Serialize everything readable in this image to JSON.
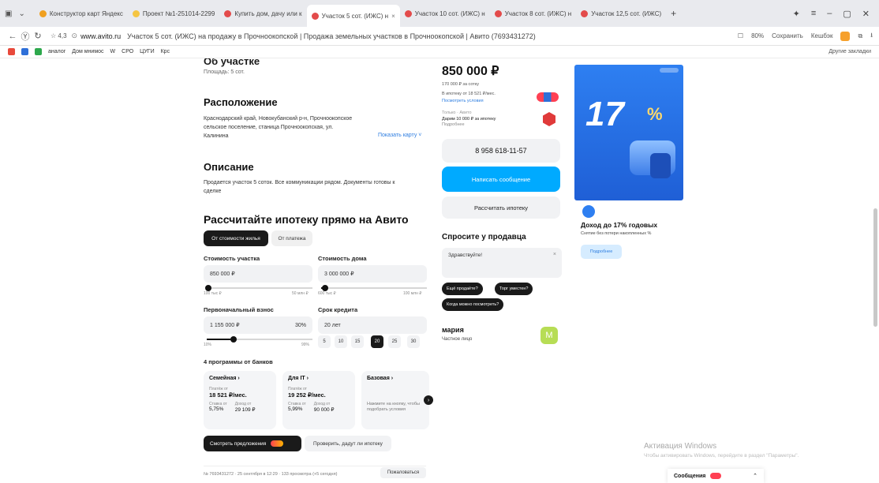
{
  "browser": {
    "tabs": [
      {
        "label": "Конструктор карт Яндекс",
        "color": "#f0a020"
      },
      {
        "label": "Проект №1-251014-2299",
        "color": "#f5c542"
      },
      {
        "label": "Купить дом, дачу или к",
        "color": "#e34b4b"
      },
      {
        "label": "Участок 5 сот. (ИЖС) н",
        "color": "#e34b4b"
      },
      {
        "label": "Участок 10 сот. (ИЖС) н",
        "color": "#e34b4b"
      },
      {
        "label": "Участок 8 сот. (ИЖС) н",
        "color": "#e34b4b"
      },
      {
        "label": "Участок 12,5 сот. (ИЖС)",
        "color": "#e34b4b"
      }
    ],
    "rating": "☆ 4,3",
    "url": "www.avito.ru",
    "page_title": "Участок 5 сот. (ИЖС) на продажу в Прочноокопской | Продажа земельных участков в Прочноокопской | Авито (7693431272)",
    "zoom": "80%",
    "save_label": "Сохранить",
    "cashback_label": "Кешбэк",
    "bookmarks": [
      "аналог",
      "Дом мнимос",
      "W",
      "СРО",
      "ЦУГИ",
      "Крс"
    ],
    "other_bookmarks": "Другие закладки"
  },
  "listing": {
    "about_title": "Об участке",
    "area": "Площадь: 5 сот.",
    "location_title": "Расположение",
    "address_line1": "Краснодарский край, Новокубанский р-н, Прочноокопское",
    "address_line2": "сельское поселение, станица Прочноокопская, ул.",
    "address_line3": "Калинина",
    "show_map": "Показать карту ˅",
    "description_title": "Описание",
    "description_line1": "Продается участок 5 соток. Все коммуникации рядом. Документы готовы к",
    "description_line2": "сделке"
  },
  "mortgage": {
    "title": "Рассчитайте ипотеку прямо на Авито",
    "toggle_by_price": "От стоимости жилья",
    "toggle_by_payment": "От платежа",
    "land_label": "Стоимость участка",
    "land_value": "850 000 ₽",
    "land_min": "100 тыс ₽",
    "land_max": "50 млн ₽",
    "house_label": "Стоимость дома",
    "house_value": "3 000 000 ₽",
    "house_min": "600 тыс ₽",
    "house_max": "100 млн ₽",
    "down_label": "Первоначальный взнос",
    "down_value": "1 155 000 ₽",
    "down_percent": "30%",
    "down_min": "10%",
    "down_max": "99%",
    "term_label": "Срок кредита",
    "term_value": "20 лет",
    "terms": [
      "5",
      "10",
      "15",
      "20",
      "25",
      "30"
    ],
    "programs_title": "4 программы от банков",
    "banks": [
      {
        "name": "Семейная ›",
        "cap": "Платёж от",
        "payment": "18 521 ₽/мес.",
        "rate_cap": "Ставка от",
        "rate": "5,75%",
        "down_cap": "Доход от",
        "down": "29 109 ₽"
      },
      {
        "name": "Для IT ›",
        "cap": "Платёж от",
        "payment": "19 252 ₽/мес.",
        "rate_cap": "Ставка от",
        "rate": "5,99%",
        "down_cap": "Доход от",
        "down": "90 000 ₽"
      },
      {
        "name": "Базовая ›",
        "note": "Нажмите на кнопку, чтобы подобрать условия"
      }
    ],
    "offers_button": "Смотреть предложения",
    "check_button": "Проверить, дадут ли ипотеку"
  },
  "footer": {
    "meta": "№ 7693431272 · 25 сентября в 12:29 · 133 просмотра (+5 сегодня)",
    "complain": "Пожаловаться"
  },
  "sidebar": {
    "price": "850 000 ₽",
    "per_sotka": "170 000 ₽ за сотку",
    "mortgage_from": "В ипотеку от 18 521 ₽/мес.",
    "see_terms": "Посмотреть условия",
    "gift_small": "Только · Авито",
    "gift_text": "Дарим 10 000 ₽ за ипотеку",
    "gift_more": "Подробнее",
    "phone": "8 958 618-11-57",
    "write_button": "Написать сообщение",
    "calc_button": "Рассчитать ипотеку",
    "ask_title": "Спросите у продавца",
    "ask_placeholder": "Здравствуйте!",
    "ask_chips": [
      "Ещё продаёте?",
      "Торг уместен?",
      "Когда можно посмотреть?"
    ],
    "seller_name": "мария",
    "seller_type": "Частное лицо",
    "avatar_letter": "М"
  },
  "ad": {
    "big_number": "17",
    "title": "Доход до 17% годовых",
    "subtitle": "Снятие без потери накопленных %",
    "button": "Подробнее"
  },
  "os": {
    "activation_title": "Активация Windows",
    "activation_sub": "Чтобы активировать Windows, перейдите в раздел \"Параметры\".",
    "messages_label": "Сообщения"
  }
}
